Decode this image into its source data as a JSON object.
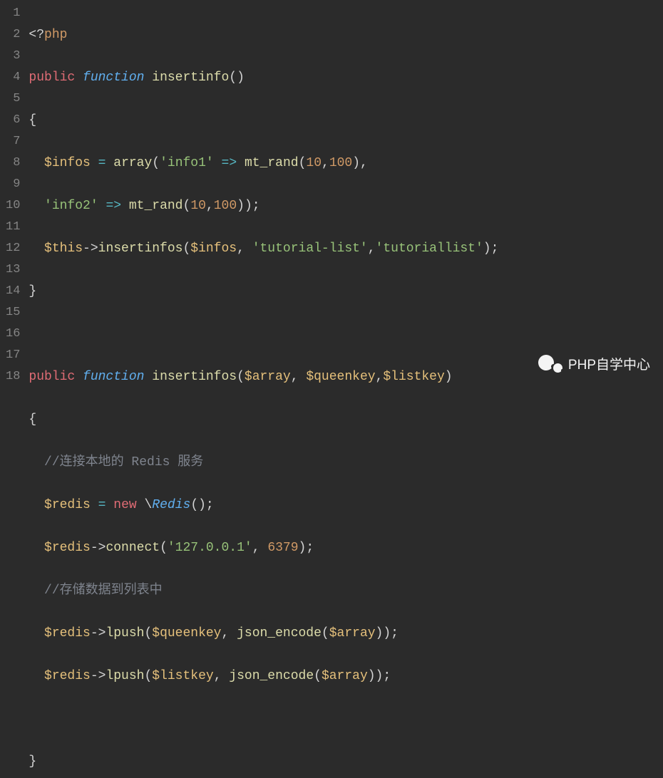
{
  "lineCount": 18,
  "code": {
    "l1": {
      "open": "<?",
      "tag": "php"
    },
    "l2": {
      "mod": "public",
      "fn": "function",
      "name": "insertinfo",
      "p": "()"
    },
    "l3": {
      "brace": "{"
    },
    "l4": {
      "var": "$infos",
      "eq": "=",
      "call": "array",
      "op1": "(",
      "s1": "'info1'",
      "arrow": "=>",
      "call2": "mt_rand",
      "op2": "(",
      "n1": "10",
      "c": ",",
      "n2": "100",
      "cl": "),"
    },
    "l5": {
      "s1": "'info2'",
      "arrow": "=>",
      "call": "mt_rand",
      "op": "(",
      "n1": "10",
      "c": ",",
      "n2": "100",
      "cl": "));"
    },
    "l6": {
      "var": "$this",
      "arrow": "->",
      "call": "insertinfos",
      "op": "(",
      "v2": "$infos",
      "c": ", ",
      "s1": "'tutorial-list'",
      "c2": ",",
      "s2": "'tutoriallist'",
      "cl": ");"
    },
    "l7": {
      "brace": "}"
    },
    "l9": {
      "mod": "public",
      "fn": "function",
      "name": "insertinfos",
      "op": "(",
      "v1": "$array",
      "c1": ", ",
      "v2": "$queenkey",
      "c2": ",",
      "v3": "$listkey",
      "cl": ")"
    },
    "l10": {
      "brace": "{"
    },
    "l11": {
      "comment": "//连接本地的 Redis 服务"
    },
    "l12": {
      "var": "$redis",
      "eq": "=",
      "new": "new",
      "bs": "\\",
      "cls": "Redis",
      "cl": "();"
    },
    "l13": {
      "var": "$redis",
      "arrow": "->",
      "call": "connect",
      "op": "(",
      "s1": "'127.0.0.1'",
      "c": ", ",
      "n1": "6379",
      "cl": ");"
    },
    "l14": {
      "comment": "//存储数据到列表中"
    },
    "l15": {
      "var": "$redis",
      "arrow": "->",
      "call": "lpush",
      "op": "(",
      "v2": "$queenkey",
      "c": ", ",
      "call2": "json_encode",
      "op2": "(",
      "v3": "$array",
      "cl": "));"
    },
    "l16": {
      "var": "$redis",
      "arrow": "->",
      "call": "lpush",
      "op": "(",
      "v2": "$listkey",
      "c": ", ",
      "call2": "json_encode",
      "op2": "(",
      "v3": "$array",
      "cl": "));"
    },
    "l18": {
      "brace": "}"
    }
  },
  "watermark": {
    "text": "PHP自学中心"
  }
}
